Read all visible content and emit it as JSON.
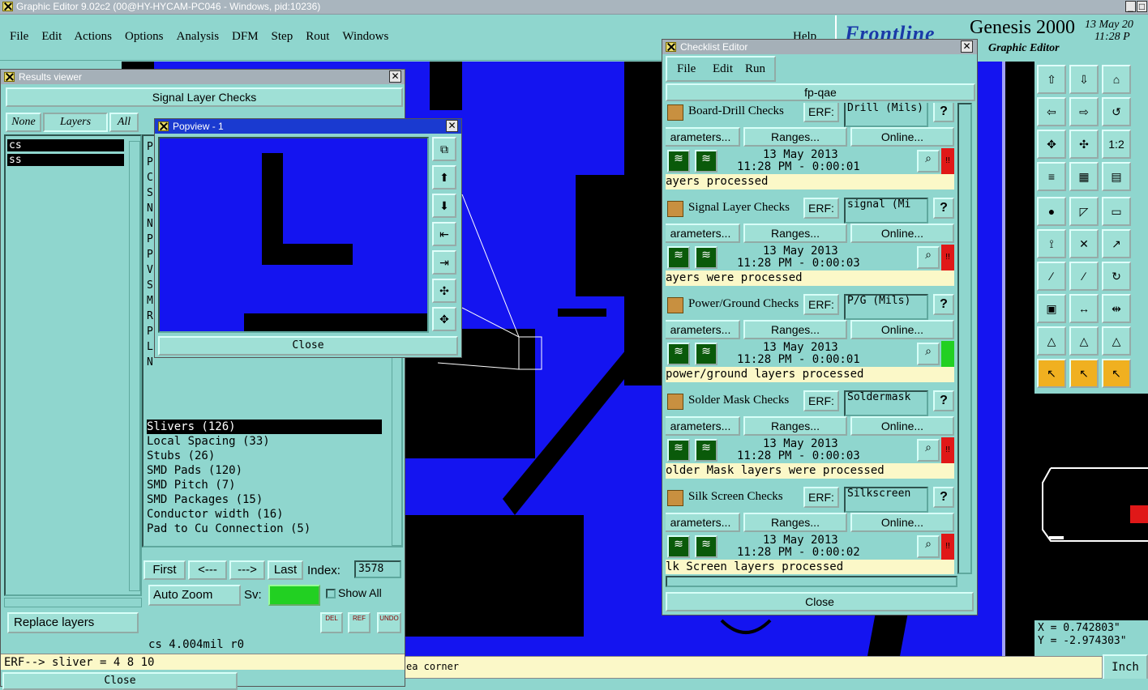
{
  "window": {
    "title": "Graphic Editor 9.02c2 (00@HY-HYCAM-PC046 - Windows, pid:10236)"
  },
  "menu": [
    "File",
    "Edit",
    "Actions",
    "Options",
    "Analysis",
    "DFM",
    "Step",
    "Rout",
    "Windows"
  ],
  "help": "Help",
  "brand": {
    "logo": "Frontline",
    "product": "Genesis 2000",
    "sub": "Graphic Editor",
    "date": "13 May 20",
    "time": "11:28 P"
  },
  "results": {
    "title": "Results viewer",
    "header": "Signal Layer Checks",
    "tabs": [
      "None",
      "Layers",
      "All"
    ],
    "layers": [
      "cs",
      "ss"
    ],
    "first_letters": [
      "P",
      "P",
      "C",
      "S",
      "N",
      "N",
      "P",
      "P",
      "V",
      "S",
      "M",
      "R",
      "P",
      "L",
      "N"
    ],
    "items": [
      "Slivers (126)",
      "Local Spacing (33)",
      "Stubs (26)",
      "SMD Pads (120)",
      "SMD Pitch (7)",
      "SMD Packages (15)",
      "Conductor width (16)",
      "Pad to Cu Connection (5)"
    ],
    "nav": {
      "first": "First",
      "prev": "<---",
      "next": "--->",
      "last": "Last",
      "index_label": "Index:",
      "index": "3578"
    },
    "auto_zoom": "Auto Zoom",
    "sv": "Sv:",
    "show_all": "Show All",
    "replace": "Replace layers",
    "icons": [
      "DEL",
      "REF",
      "UNDO"
    ],
    "info": "cs 4.004mil  r0",
    "erf": "ERF--> sliver = 4 8 10",
    "close": "Close"
  },
  "popview": {
    "title": "Popview - 1",
    "letter": "L",
    "close": "Close"
  },
  "checklist": {
    "title": "Checklist Editor",
    "menu": [
      "File",
      "Edit",
      "Run"
    ],
    "name": "fp-qae",
    "rows": [
      {
        "name": "Board-Drill Checks",
        "erf": "ERF:",
        "erfval": "Drill (Mils)",
        "date": "13 May 2013",
        "time": "11:28 PM - 0:00:01",
        "msg": "ayers processed",
        "status": "red"
      },
      {
        "name": "Signal Layer Checks",
        "erf": "ERF:",
        "erfval": "signal (Mi",
        "date": "13 May 2013",
        "time": "11:28 PM - 0:00:03",
        "msg": "ayers were processed",
        "status": "red"
      },
      {
        "name": "Power/Ground Checks",
        "erf": "ERF:",
        "erfval": "P/G (Mils)",
        "date": "13 May 2013",
        "time": "11:28 PM - 0:00:01",
        "msg": "power/ground layers processed",
        "status": "green"
      },
      {
        "name": "Solder Mask Checks",
        "erf": "ERF:",
        "erfval": "Soldermask",
        "date": "13 May 2013",
        "time": "11:28 PM - 0:00:03",
        "msg": "older Mask layers were processed",
        "status": "red"
      },
      {
        "name": "Silk Screen Checks",
        "erf": "ERF:",
        "erfval": "Silkscreen",
        "date": "13 May 2013",
        "time": "11:28 PM - 0:00:02",
        "msg": "lk Screen layers processed",
        "status": "red"
      }
    ],
    "params": "arameters...",
    "ranges": "Ranges...",
    "online": "Online...",
    "q": "?",
    "close": "Close"
  },
  "coords": {
    "x": "X = 0.742803\"",
    "y": "Y = -2.974303\""
  },
  "status": {
    "text": "ea corner",
    "units": "Inch"
  },
  "colors": {
    "bg": "#8fd6ce",
    "canvas": "#1414f0",
    "board": "#000000",
    "alert": "#e01818",
    "ok": "#22d022"
  }
}
